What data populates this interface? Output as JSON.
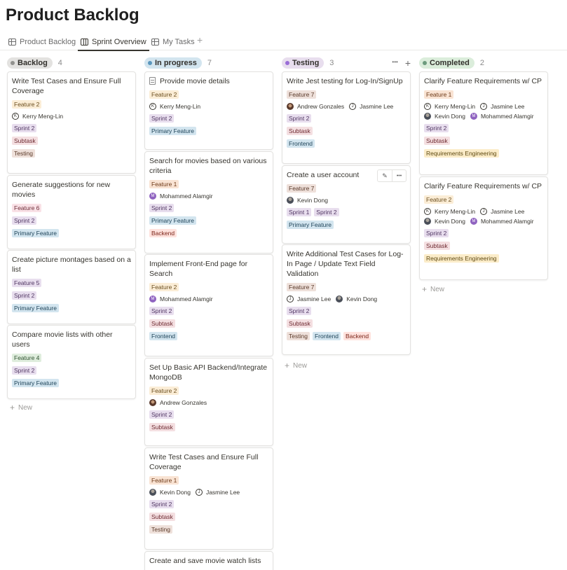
{
  "page": {
    "title": "Product Backlog"
  },
  "tabs": [
    {
      "label": "Product Backlog",
      "icon": "table-icon"
    },
    {
      "label": "Sprint Overview",
      "icon": "board-icon",
      "active": true
    },
    {
      "label": "My Tasks",
      "icon": "table-icon"
    }
  ],
  "add_symbol": "+",
  "new_label": "New",
  "columns": [
    {
      "name": "Backlog",
      "count": "4",
      "color": "#e3e2e0",
      "dot": "#91918e",
      "cards": [
        {
          "title": "Write Test Cases and Ensure Full Coverage",
          "tags1": [
            [
              "Feature 2",
              "t-feat-yellow"
            ]
          ],
          "people": [
            [
              "Kerry Meng-Lin",
              "K"
            ]
          ],
          "tags2": [
            [
              "Sprint 2",
              "t-sprint"
            ]
          ],
          "tags3": [
            [
              "Subtask",
              "t-subtask"
            ]
          ],
          "tags4": [
            [
              "Testing",
              "t-testing"
            ]
          ]
        },
        {
          "title": "Generate suggestions for new movies",
          "tags1": [
            [
              "Feature 6",
              "t-feat-pink"
            ]
          ],
          "tags2": [
            [
              "Sprint 2",
              "t-sprint"
            ]
          ],
          "tags3": [
            [
              "Primary Feature",
              "t-primary"
            ]
          ]
        },
        {
          "title": "Create picture montages based on a list",
          "tags1": [
            [
              "Feature 5",
              "t-sprint"
            ]
          ],
          "tags2": [
            [
              "Sprint 2",
              "t-sprint"
            ]
          ],
          "tags3": [
            [
              "Primary Feature",
              "t-primary"
            ]
          ]
        },
        {
          "title": "Compare movie lists with other users",
          "tags1": [
            [
              "Feature 4",
              "t-feat-green"
            ]
          ],
          "tags2": [
            [
              "Sprint 2",
              "t-sprint"
            ]
          ],
          "tags3": [
            [
              "Primary Feature",
              "t-primary"
            ]
          ]
        }
      ]
    },
    {
      "name": "In progress",
      "count": "7",
      "color": "#d3e5ef",
      "dot": "#5b97bd",
      "cards": [
        {
          "title": "Provide movie details",
          "doc": true,
          "tags1": [
            [
              "Feature 2",
              "t-feat-yellow"
            ]
          ],
          "people": [
            [
              "Kerry Meng-Lin",
              "K"
            ]
          ],
          "tags2": [
            [
              "Sprint 2",
              "t-sprint"
            ]
          ],
          "tags3": [
            [
              "Primary Feature",
              "t-primary"
            ]
          ]
        },
        {
          "title": "Search for movies based on various criteria",
          "tags1": [
            [
              "Feature 1",
              "t-feat-orange"
            ]
          ],
          "people": [
            [
              "Mohammed Alamgir",
              "M"
            ]
          ],
          "tags2": [
            [
              "Sprint 2",
              "t-sprint"
            ]
          ],
          "tags3": [
            [
              "Primary Feature",
              "t-primary"
            ]
          ],
          "tags4": [
            [
              "Backend",
              "t-backend"
            ]
          ]
        },
        {
          "title": "Implement Front-End page for Search",
          "tags1": [
            [
              "Feature 2",
              "t-feat-yellow"
            ]
          ],
          "people": [
            [
              "Mohammed Alamgir",
              "M"
            ]
          ],
          "tags2": [
            [
              "Sprint 2",
              "t-sprint"
            ]
          ],
          "tags3": [
            [
              "Subtask",
              "t-subtask"
            ]
          ],
          "tags4": [
            [
              "Frontend",
              "t-frontend"
            ]
          ]
        },
        {
          "title": "Set Up Basic API Backend/Integrate MongoDB",
          "tags1": [
            [
              "Feature 2",
              "t-feat-yellow"
            ]
          ],
          "people": [
            [
              "Andrew Gonzales",
              "A"
            ]
          ],
          "tags2": [
            [
              "Sprint 2",
              "t-sprint"
            ]
          ],
          "tags3": [
            [
              "Subtask",
              "t-subtask"
            ]
          ]
        },
        {
          "title": "Write Test Cases and Ensure Full Coverage",
          "tags1": [
            [
              "Feature 1",
              "t-feat-orange"
            ]
          ],
          "people": [
            [
              "Kevin Dong",
              "KD"
            ],
            [
              "Jasmine Lee",
              "J"
            ]
          ],
          "tags2": [
            [
              "Sprint 2",
              "t-sprint"
            ]
          ],
          "tags3": [
            [
              "Subtask",
              "t-subtask"
            ]
          ],
          "tags4": [
            [
              "Testing",
              "t-testing"
            ]
          ]
        },
        {
          "title": "Create and save movie watch lists"
        }
      ]
    },
    {
      "name": "Testing",
      "count": "3",
      "color": "#e8deee",
      "dot": "#9a6dd7",
      "cards": [
        {
          "title": "Write Jest testing for Log-In/SignUp",
          "tags1": [
            [
              "Feature 7",
              "t-feat-brown"
            ]
          ],
          "people": [
            [
              "Andrew Gonzales",
              "A"
            ],
            [
              "Jasmine Lee",
              "J"
            ]
          ],
          "tags2": [
            [
              "Sprint 2",
              "t-sprint"
            ]
          ],
          "tags3": [
            [
              "Subtask",
              "t-subtask"
            ]
          ],
          "tags4": [
            [
              "Frontend",
              "t-frontend"
            ]
          ]
        },
        {
          "title": "Create a user account",
          "tools": true,
          "tags1": [
            [
              "Feature 7",
              "t-feat-brown"
            ]
          ],
          "people": [
            [
              "Kevin Dong",
              "KD"
            ]
          ],
          "tags2": [
            [
              "Sprint 1",
              "t-sprint"
            ],
            [
              "Sprint 2",
              "t-sprint"
            ]
          ],
          "tags3": [
            [
              "Primary Feature",
              "t-primary"
            ]
          ]
        },
        {
          "title": "Write Additional Test Cases for Log-In Page / Update Text Field Validation",
          "tags1": [
            [
              "Feature 7",
              "t-feat-brown"
            ]
          ],
          "people": [
            [
              "Jasmine Lee",
              "J"
            ],
            [
              "Kevin Dong",
              "KD"
            ]
          ],
          "tags2": [
            [
              "Sprint 2",
              "t-sprint"
            ]
          ],
          "tags3": [
            [
              "Subtask",
              "t-subtask"
            ]
          ],
          "tags4": [
            [
              "Testing",
              "t-testing"
            ],
            [
              "Frontend",
              "t-frontend"
            ],
            [
              "Backend",
              "t-backend"
            ]
          ]
        }
      ]
    },
    {
      "name": "Completed",
      "count": "2",
      "color": "#dbeddb",
      "dot": "#6c9b7d",
      "cards": [
        {
          "title": "Clarify Feature Requirements w/ CP",
          "tags1": [
            [
              "Feature 1",
              "t-feat-orange"
            ]
          ],
          "people": [
            [
              "Kerry Meng-Lin",
              "K"
            ],
            [
              "Jasmine Lee",
              "J"
            ],
            [
              "Kevin Dong",
              "KD"
            ],
            [
              "Mohammed Alamgir",
              "M"
            ]
          ],
          "tags2": [
            [
              "Sprint 2",
              "t-sprint"
            ]
          ],
          "tags3": [
            [
              "Subtask",
              "t-subtask"
            ]
          ],
          "tags4": [
            [
              "Requirements Engineering",
              "t-req"
            ]
          ]
        },
        {
          "title": "Clarify Feature Requirements w/ CP",
          "tags1": [
            [
              "Feature 2",
              "t-feat-yellow"
            ]
          ],
          "people": [
            [
              "Kerry Meng-Lin",
              "K"
            ],
            [
              "Jasmine Lee",
              "J"
            ],
            [
              "Kevin Dong",
              "KD"
            ],
            [
              "Mohammed Alamgir",
              "M"
            ]
          ],
          "tags2": [
            [
              "Sprint 2",
              "t-sprint"
            ]
          ],
          "tags3": [
            [
              "Subtask",
              "t-subtask"
            ]
          ],
          "tags4": [
            [
              "Requirements Engineering",
              "t-req"
            ]
          ]
        }
      ]
    }
  ],
  "testing_actions": {
    "more": "•••",
    "add": "+"
  },
  "card_tools": {
    "edit": "✎",
    "more": "•••"
  }
}
